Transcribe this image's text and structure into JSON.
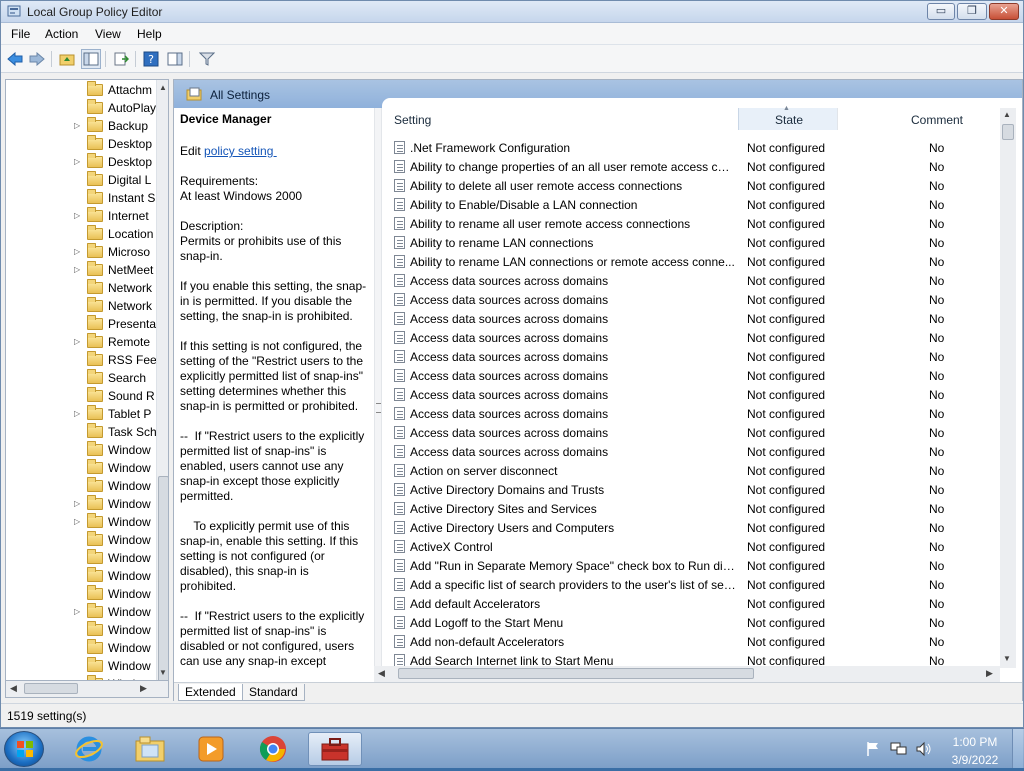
{
  "window": {
    "title": "Local Group Policy Editor"
  },
  "titlebar_buttons": {
    "minimize": "▭",
    "maximize": "❐",
    "close": "✕"
  },
  "menu": {
    "items": [
      "File",
      "Action",
      "View",
      "Help"
    ]
  },
  "tree": {
    "items": [
      {
        "label": "Attachm",
        "expandable": false
      },
      {
        "label": "AutoPlay",
        "expandable": false
      },
      {
        "label": "Backup",
        "expandable": true
      },
      {
        "label": "Desktop",
        "expandable": false
      },
      {
        "label": "Desktop",
        "expandable": true
      },
      {
        "label": "Digital L",
        "expandable": false
      },
      {
        "label": "Instant S",
        "expandable": false
      },
      {
        "label": "Internet",
        "expandable": true
      },
      {
        "label": "Location",
        "expandable": false
      },
      {
        "label": "Microso",
        "expandable": true
      },
      {
        "label": "NetMeet",
        "expandable": true
      },
      {
        "label": "Network",
        "expandable": false
      },
      {
        "label": "Network",
        "expandable": false
      },
      {
        "label": "Presenta",
        "expandable": false
      },
      {
        "label": "Remote",
        "expandable": true
      },
      {
        "label": "RSS Feed",
        "expandable": false
      },
      {
        "label": "Search",
        "expandable": false
      },
      {
        "label": "Sound R",
        "expandable": false
      },
      {
        "label": "Tablet P",
        "expandable": true
      },
      {
        "label": "Task Sch",
        "expandable": false
      },
      {
        "label": "Window",
        "expandable": false
      },
      {
        "label": "Window",
        "expandable": false
      },
      {
        "label": "Window",
        "expandable": false
      },
      {
        "label": "Window",
        "expandable": true
      },
      {
        "label": "Window",
        "expandable": true
      },
      {
        "label": "Window",
        "expandable": false
      },
      {
        "label": "Window",
        "expandable": false
      },
      {
        "label": "Window",
        "expandable": false
      },
      {
        "label": "Window",
        "expandable": false
      },
      {
        "label": "Window",
        "expandable": true
      },
      {
        "label": "Window",
        "expandable": false
      },
      {
        "label": "Window",
        "expandable": false
      },
      {
        "label": "Window",
        "expandable": false
      },
      {
        "label": "Window",
        "expandable": false
      }
    ]
  },
  "header": {
    "title": "All Settings"
  },
  "detail": {
    "title": "Device Manager",
    "edit_prefix": "Edit ",
    "edit_link": "policy setting ",
    "requirements_label": "Requirements:",
    "requirements_value": "At least Windows 2000",
    "description_label": "Description:",
    "description": "Permits or prohibits use of this snap-in.\n\nIf you enable this setting, the snap-in is permitted. If you disable the setting, the snap-in is prohibited.\n\nIf this setting is not configured, the setting of the \"Restrict users to the explicitly permitted list of snap-ins\" setting determines whether this snap-in is permitted or prohibited.\n\n--  If \"Restrict users to the explicitly permitted list of snap-ins\" is enabled, users cannot use any snap-in except those explicitly permitted.\n\n    To explicitly permit use of this snap-in, enable this setting. If this setting is not configured (or disabled), this snap-in is prohibited.\n\n--  If \"Restrict users to the explicitly permitted list of snap-ins\" is disabled or not configured, users can use any snap-in except"
  },
  "columns": {
    "setting": "Setting",
    "state": "State",
    "comment": "Comment"
  },
  "rows": [
    {
      "setting": ".Net Framework Configuration",
      "state": "Not configured",
      "comment": "No"
    },
    {
      "setting": "Ability to change properties of an all user remote access con...",
      "state": "Not configured",
      "comment": "No"
    },
    {
      "setting": "Ability to delete all user remote access connections",
      "state": "Not configured",
      "comment": "No"
    },
    {
      "setting": "Ability to Enable/Disable a LAN connection",
      "state": "Not configured",
      "comment": "No"
    },
    {
      "setting": "Ability to rename all user remote access connections",
      "state": "Not configured",
      "comment": "No"
    },
    {
      "setting": "Ability to rename LAN connections",
      "state": "Not configured",
      "comment": "No"
    },
    {
      "setting": "Ability to rename LAN connections or remote access conne...",
      "state": "Not configured",
      "comment": "No"
    },
    {
      "setting": "Access data sources across domains",
      "state": "Not configured",
      "comment": "No"
    },
    {
      "setting": "Access data sources across domains",
      "state": "Not configured",
      "comment": "No"
    },
    {
      "setting": "Access data sources across domains",
      "state": "Not configured",
      "comment": "No"
    },
    {
      "setting": "Access data sources across domains",
      "state": "Not configured",
      "comment": "No"
    },
    {
      "setting": "Access data sources across domains",
      "state": "Not configured",
      "comment": "No"
    },
    {
      "setting": "Access data sources across domains",
      "state": "Not configured",
      "comment": "No"
    },
    {
      "setting": "Access data sources across domains",
      "state": "Not configured",
      "comment": "No"
    },
    {
      "setting": "Access data sources across domains",
      "state": "Not configured",
      "comment": "No"
    },
    {
      "setting": "Access data sources across domains",
      "state": "Not configured",
      "comment": "No"
    },
    {
      "setting": "Access data sources across domains",
      "state": "Not configured",
      "comment": "No"
    },
    {
      "setting": "Action on server disconnect",
      "state": "Not configured",
      "comment": "No"
    },
    {
      "setting": "Active Directory Domains and Trusts",
      "state": "Not configured",
      "comment": "No"
    },
    {
      "setting": "Active Directory Sites and Services",
      "state": "Not configured",
      "comment": "No"
    },
    {
      "setting": "Active Directory Users and Computers",
      "state": "Not configured",
      "comment": "No"
    },
    {
      "setting": "ActiveX Control",
      "state": "Not configured",
      "comment": "No"
    },
    {
      "setting": "Add \"Run in Separate Memory Space\" check box to Run dial...",
      "state": "Not configured",
      "comment": "No"
    },
    {
      "setting": "Add a specific list of search providers to the user's list of sea...",
      "state": "Not configured",
      "comment": "No"
    },
    {
      "setting": "Add default Accelerators",
      "state": "Not configured",
      "comment": "No"
    },
    {
      "setting": "Add Logoff to the Start Menu",
      "state": "Not configured",
      "comment": "No"
    },
    {
      "setting": "Add non-default Accelerators",
      "state": "Not configured",
      "comment": "No"
    },
    {
      "setting": "Add Search Internet link to Start Menu",
      "state": "Not configured",
      "comment": "No"
    }
  ],
  "tabs": [
    "Extended",
    "Standard"
  ],
  "status": {
    "text": "1519 setting(s)"
  },
  "taskbar": {
    "time": "1:00 PM",
    "date": "3/9/2022"
  },
  "colors": {
    "header_strip": "#9db9df",
    "link": "#1556b8",
    "taskbar": "#8fafd4"
  }
}
